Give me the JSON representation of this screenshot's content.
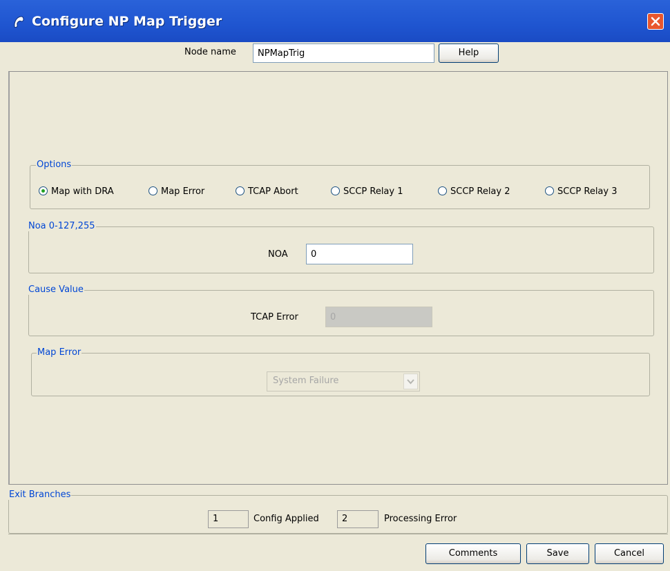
{
  "window": {
    "title": "Configure NP Map Trigger",
    "icon": "phone-handset-icon",
    "close_icon": "close-x-icon"
  },
  "header": {
    "node_name_label": "Node name",
    "node_name_value": "NPMapTrig",
    "help_label": "Help"
  },
  "options": {
    "legend": "Options",
    "radios": [
      {
        "label": "Map with DRA",
        "selected": true
      },
      {
        "label": "Map Error",
        "selected": false
      },
      {
        "label": "TCAP Abort",
        "selected": false
      },
      {
        "label": "SCCP Relay 1",
        "selected": false
      },
      {
        "label": "SCCP Relay 2",
        "selected": false
      },
      {
        "label": "SCCP Relay 3",
        "selected": false
      }
    ]
  },
  "noa": {
    "legend": "Noa 0-127,255",
    "label": "NOA",
    "value": "0"
  },
  "cause": {
    "legend": "Cause Value",
    "label": "TCAP Error",
    "value": "0"
  },
  "map_error": {
    "legend": "Map Error",
    "selected": "System Failure"
  },
  "exit_branches": {
    "legend": "Exit Branches",
    "branches": [
      {
        "number": "1",
        "label": "Config Applied"
      },
      {
        "number": "2",
        "label": "Processing Error"
      }
    ]
  },
  "footer": {
    "comments_label": "Comments",
    "save_label": "Save",
    "cancel_label": "Cancel"
  },
  "colors": {
    "titlebar": "#1f55d0",
    "background": "#ece9d8",
    "legend_text": "#0046d5",
    "close_button": "#e8562e"
  }
}
